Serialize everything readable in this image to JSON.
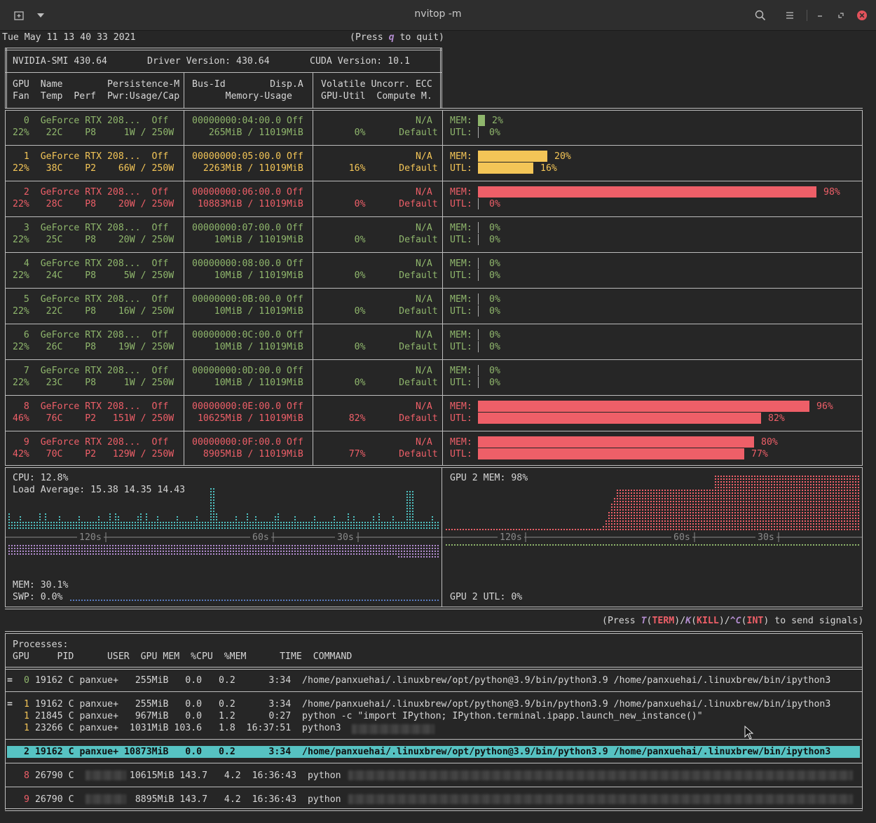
{
  "window": {
    "title": "nvitop -m"
  },
  "header": {
    "datetime": "Tue May 11 13 40 33 2021",
    "quit_pre": "(Press ",
    "quit_key": "q",
    "quit_post": " to quit)"
  },
  "smi": {
    "nvidia_smi": "NVIDIA-SMI 430.64",
    "driver": "Driver Version: 430.64",
    "cuda": "CUDA Version: 10.1"
  },
  "columns": {
    "c1a": "GPU  Name        Persistence-M",
    "c1b": "Fan  Temp  Perf  Pwr:Usage/Cap",
    "c2a": "Bus-Id        Disp.A",
    "c2b": "      Memory-Usage",
    "c3a": "Volatile Uncorr. ECC",
    "c3b": "GPU-Util  Compute M."
  },
  "gpus": [
    {
      "l1a": "  0  GeForce RTX 208...  Off",
      "l1b": "00000000:04:00.0 Off",
      "l1c": "                 N/A",
      "l2a": "22%   22C    P8     1W / 250W",
      "l2b": "   265MiB / 11019MiB",
      "l2c": "      0%      Default",
      "mem_pct": "2%",
      "utl_pct": "0%",
      "mem": 0.02,
      "utl": 0.0,
      "color": "#8fb66c",
      "cls": "g"
    },
    {
      "l1a": "  1  GeForce RTX 208...  Off",
      "l1b": "00000000:05:00.0 Off",
      "l1c": "                 N/A",
      "l2a": "22%   38C    P2    66W / 250W",
      "l2b": "  2263MiB / 11019MiB",
      "l2c": "     16%      Default",
      "mem_pct": "20%",
      "utl_pct": "16%",
      "mem": 0.2,
      "utl": 0.16,
      "color": "#f3c557",
      "cls": "y"
    },
    {
      "l1a": "  2  GeForce RTX 208...  Off",
      "l1b": "00000000:06:00.0 Off",
      "l1c": "                 N/A",
      "l2a": "22%   28C    P8    20W / 250W",
      "l2b": " 10883MiB / 11019MiB",
      "l2c": "      0%      Default",
      "mem_pct": "98%",
      "utl_pct": "0%",
      "mem": 0.98,
      "utl": 0.0,
      "color": "#ee5f68",
      "cls": "r"
    },
    {
      "l1a": "  3  GeForce RTX 208...  Off",
      "l1b": "00000000:07:00.0 Off",
      "l1c": "                 N/A",
      "l2a": "22%   25C    P8    20W / 250W",
      "l2b": "    10MiB / 11019MiB",
      "l2c": "      0%      Default",
      "mem_pct": "0%",
      "utl_pct": "0%",
      "mem": 0.0,
      "utl": 0.0,
      "color": "#8fb66c",
      "cls": "g"
    },
    {
      "l1a": "  4  GeForce RTX 208...  Off",
      "l1b": "00000000:08:00.0 Off",
      "l1c": "                 N/A",
      "l2a": "22%   24C    P8     5W / 250W",
      "l2b": "    10MiB / 11019MiB",
      "l2c": "      0%      Default",
      "mem_pct": "0%",
      "utl_pct": "0%",
      "mem": 0.0,
      "utl": 0.0,
      "color": "#8fb66c",
      "cls": "g"
    },
    {
      "l1a": "  5  GeForce RTX 208...  Off",
      "l1b": "00000000:0B:00.0 Off",
      "l1c": "                 N/A",
      "l2a": "22%   22C    P8    16W / 250W",
      "l2b": "    10MiB / 11019MiB",
      "l2c": "      0%      Default",
      "mem_pct": "0%",
      "utl_pct": "0%",
      "mem": 0.0,
      "utl": 0.0,
      "color": "#8fb66c",
      "cls": "g"
    },
    {
      "l1a": "  6  GeForce RTX 208...  Off",
      "l1b": "00000000:0C:00.0 Off",
      "l1c": "                 N/A",
      "l2a": "22%   26C    P8    19W / 250W",
      "l2b": "    10MiB / 11019MiB",
      "l2c": "      0%      Default",
      "mem_pct": "0%",
      "utl_pct": "0%",
      "mem": 0.0,
      "utl": 0.0,
      "color": "#8fb66c",
      "cls": "g"
    },
    {
      "l1a": "  7  GeForce RTX 208...  Off",
      "l1b": "00000000:0D:00.0 Off",
      "l1c": "                 N/A",
      "l2a": "22%   23C    P8     1W / 250W",
      "l2b": "    10MiB / 11019MiB",
      "l2c": "      0%      Default",
      "mem_pct": "0%",
      "utl_pct": "0%",
      "mem": 0.0,
      "utl": 0.0,
      "color": "#8fb66c",
      "cls": "g"
    },
    {
      "l1a": "  8  GeForce RTX 208...  Off",
      "l1b": "00000000:0E:00.0 Off",
      "l1c": "                 N/A",
      "l2a": "46%   76C    P2   151W / 250W",
      "l2b": " 10625MiB / 11019MiB",
      "l2c": "     82%      Default",
      "mem_pct": "96%",
      "utl_pct": "82%",
      "mem": 0.96,
      "utl": 0.82,
      "color": "#ee5f68",
      "cls": "r"
    },
    {
      "l1a": "  9  GeForce RTX 208...  Off",
      "l1b": "00000000:0F:00.0 Off",
      "l1c": "                 N/A",
      "l2a": "42%   70C    P2   129W / 250W",
      "l2b": "  8905MiB / 11019MiB",
      "l2c": "     77%      Default",
      "mem_pct": "80%",
      "utl_pct": "77%",
      "mem": 0.8,
      "utl": 0.77,
      "color": "#ee5f68",
      "cls": "r"
    }
  ],
  "labels": {
    "mem": "MEM:",
    "utl": "UTL:"
  },
  "host": {
    "cpu": "CPU: 12.8%",
    "load": "Load Average: 15.38 14.35 14.43",
    "mem": "MEM: 30.1%",
    "swp": "SWP: 0.0%",
    "gpu_mem": "GPU 2 MEM: 98%",
    "gpu_utl": "GPU 2 UTL: 0%",
    "t120": "120s",
    "t60": "60s",
    "t30": "30s"
  },
  "signals": {
    "p1": "(Press ",
    "k1": "T",
    "p2": "(",
    "k2": "TERM",
    "p3": ")/",
    "k3": "K",
    "p4": "(",
    "k4": "KILL",
    "p5": ")/",
    "k5": "^C",
    "p6": "(",
    "k6": "INT",
    "p7": ") to send signals)"
  },
  "processes": {
    "title": "Processes:",
    "header": "GPU     PID      USER  GPU MEM  %CPU  %MEM      TIME  COMMAND",
    "rows": [
      {
        "mark": "=",
        "gpu": "0",
        "rest": " 19162 C panxue+   255MiB   0.0   0.2      3:34  /home/panxuehai/.linuxbrew/opt/python@3.9/bin/python3.9 /home/panxuehai/.linuxbrew/bin/ipython3"
      },
      {
        "mark": "=",
        "gpu": "1",
        "rest": " 19162 C panxue+   255MiB   0.0   0.2      3:34  /home/panxuehai/.linuxbrew/opt/python@3.9/bin/python3.9 /home/panxuehai/.linuxbrew/bin/ipython3"
      },
      {
        "mark": "",
        "gpu": "1",
        "rest": " 21845 C panxue+   967MiB   0.0   1.2      0:27  python -c \"import IPython; IPython.terminal.ipapp.launch_new_instance()\""
      },
      {
        "mark": "",
        "gpu": "1",
        "rest": " 23266 C panxue+  1031MiB 103.6   1.8  16:37:51  python3"
      },
      {
        "mark": "",
        "gpu": "2",
        "rest": " 19162 C panxue+ 10873MiB   0.0   0.2      3:34  /home/panxuehai/.linuxbrew/opt/python@3.9/bin/python3.9 /home/panxuehai/.linuxbrew/bin/ipython3"
      },
      {
        "mark": "",
        "gpu": "8",
        "rest": " 26790 C          10615MiB 143.7   4.2  16:36:43  python"
      },
      {
        "mark": "",
        "gpu": "9",
        "rest": " 26790 C           8895MiB 143.7   4.2  16:36:43  python"
      }
    ]
  },
  "icons": {
    "new_tab": "new-tab-icon",
    "dropdown": "chevron-down-icon",
    "search": "search-icon",
    "menu": "hamburger-menu-icon",
    "minimize": "minimize-icon",
    "maximize": "maximize-icon",
    "close": "close-icon"
  },
  "colors": {
    "green": "#8fb66c",
    "yellow": "#f3c557",
    "red": "#ee5f68",
    "cyan": "#4fc1c1",
    "purple": "#b28ccf",
    "highlight": "#56c2c2"
  }
}
